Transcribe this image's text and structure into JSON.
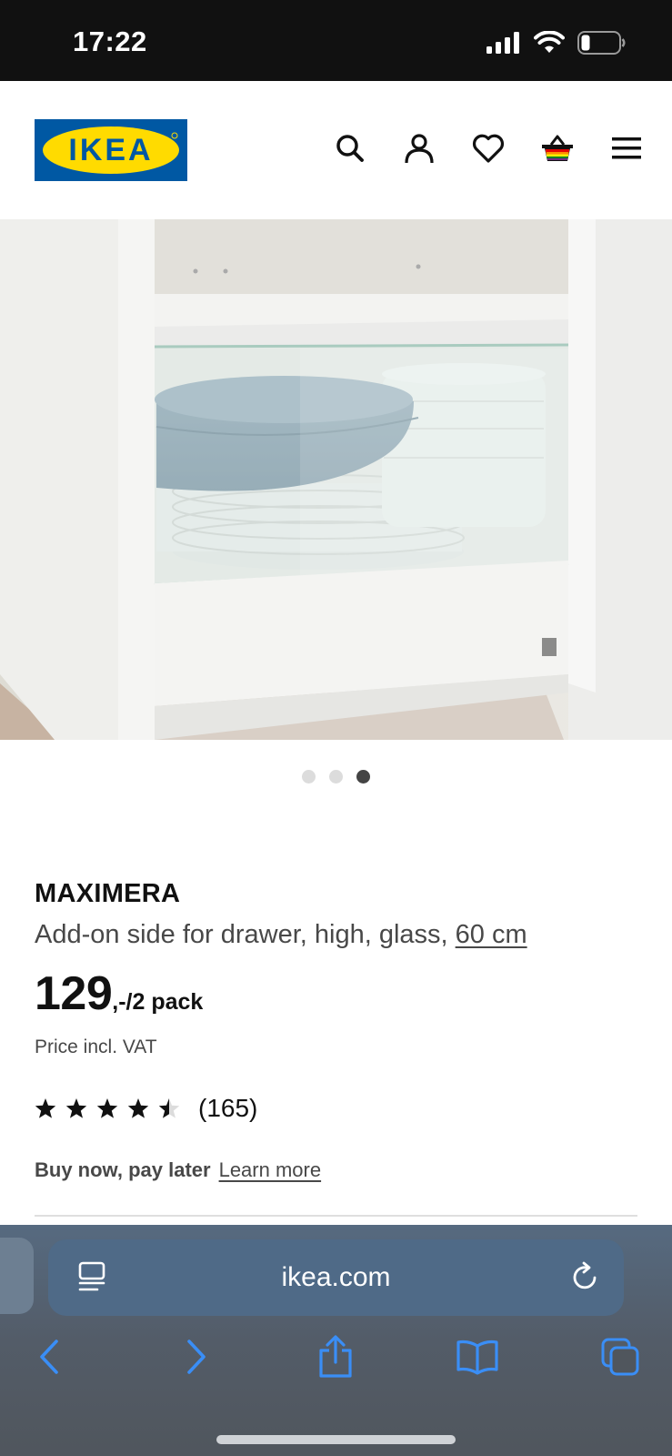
{
  "status_bar": {
    "time": "17:22"
  },
  "header": {
    "logo_text": "IKEA",
    "icons": [
      "search-icon",
      "account-icon",
      "heart-icon",
      "basket-icon",
      "menu-icon"
    ]
  },
  "carousel": {
    "total": 3,
    "active_index": 2
  },
  "product": {
    "name": "MAXIMERA",
    "description": "Add-on side for drawer, high, glass, ",
    "size": "60 cm",
    "price": "129",
    "price_suffix": ",-/2 pack",
    "vat_note": "Price incl. VAT",
    "rating": 4.5,
    "review_count": "(165)",
    "bnpl_label": "Buy now, pay later",
    "bnpl_link": "Learn more"
  },
  "browser": {
    "url": "ikea.com",
    "accent_color": "#3a8ef6"
  }
}
